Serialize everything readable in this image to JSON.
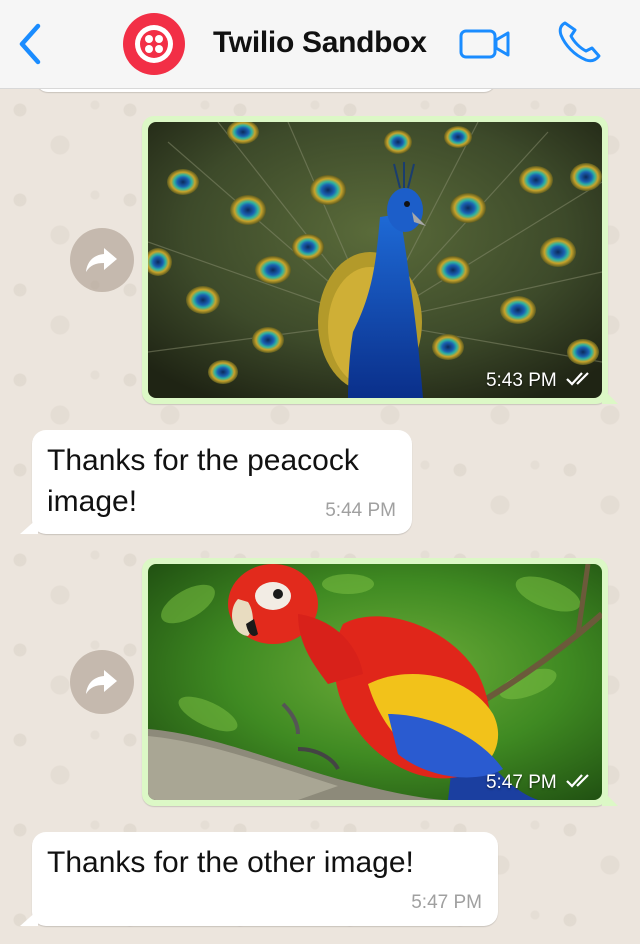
{
  "header": {
    "contact_name": "Twilio Sandbox",
    "back_icon": "chevron-left-icon",
    "video_icon": "video-camera-icon",
    "call_icon": "phone-icon",
    "accent_color": "#1a8cff",
    "avatar_color": "#f22f46"
  },
  "messages": [
    {
      "type": "image",
      "direction": "outgoing",
      "image": "peacock",
      "time": "5:43 PM",
      "status_icon": "double-check-icon"
    },
    {
      "type": "text",
      "direction": "incoming",
      "text_line1": "Thanks for the peacock",
      "text_line2": "image!",
      "time": "5:44 PM"
    },
    {
      "type": "image",
      "direction": "outgoing",
      "image": "parrot",
      "time": "5:47 PM",
      "status_icon": "double-check-icon"
    },
    {
      "type": "text",
      "direction": "incoming",
      "text": "Thanks for the other image!",
      "time": "5:47 PM"
    }
  ],
  "colors": {
    "outgoing_bubble": "#dcf8c6",
    "incoming_bubble": "#ffffff",
    "chat_background": "#ece5dd"
  }
}
